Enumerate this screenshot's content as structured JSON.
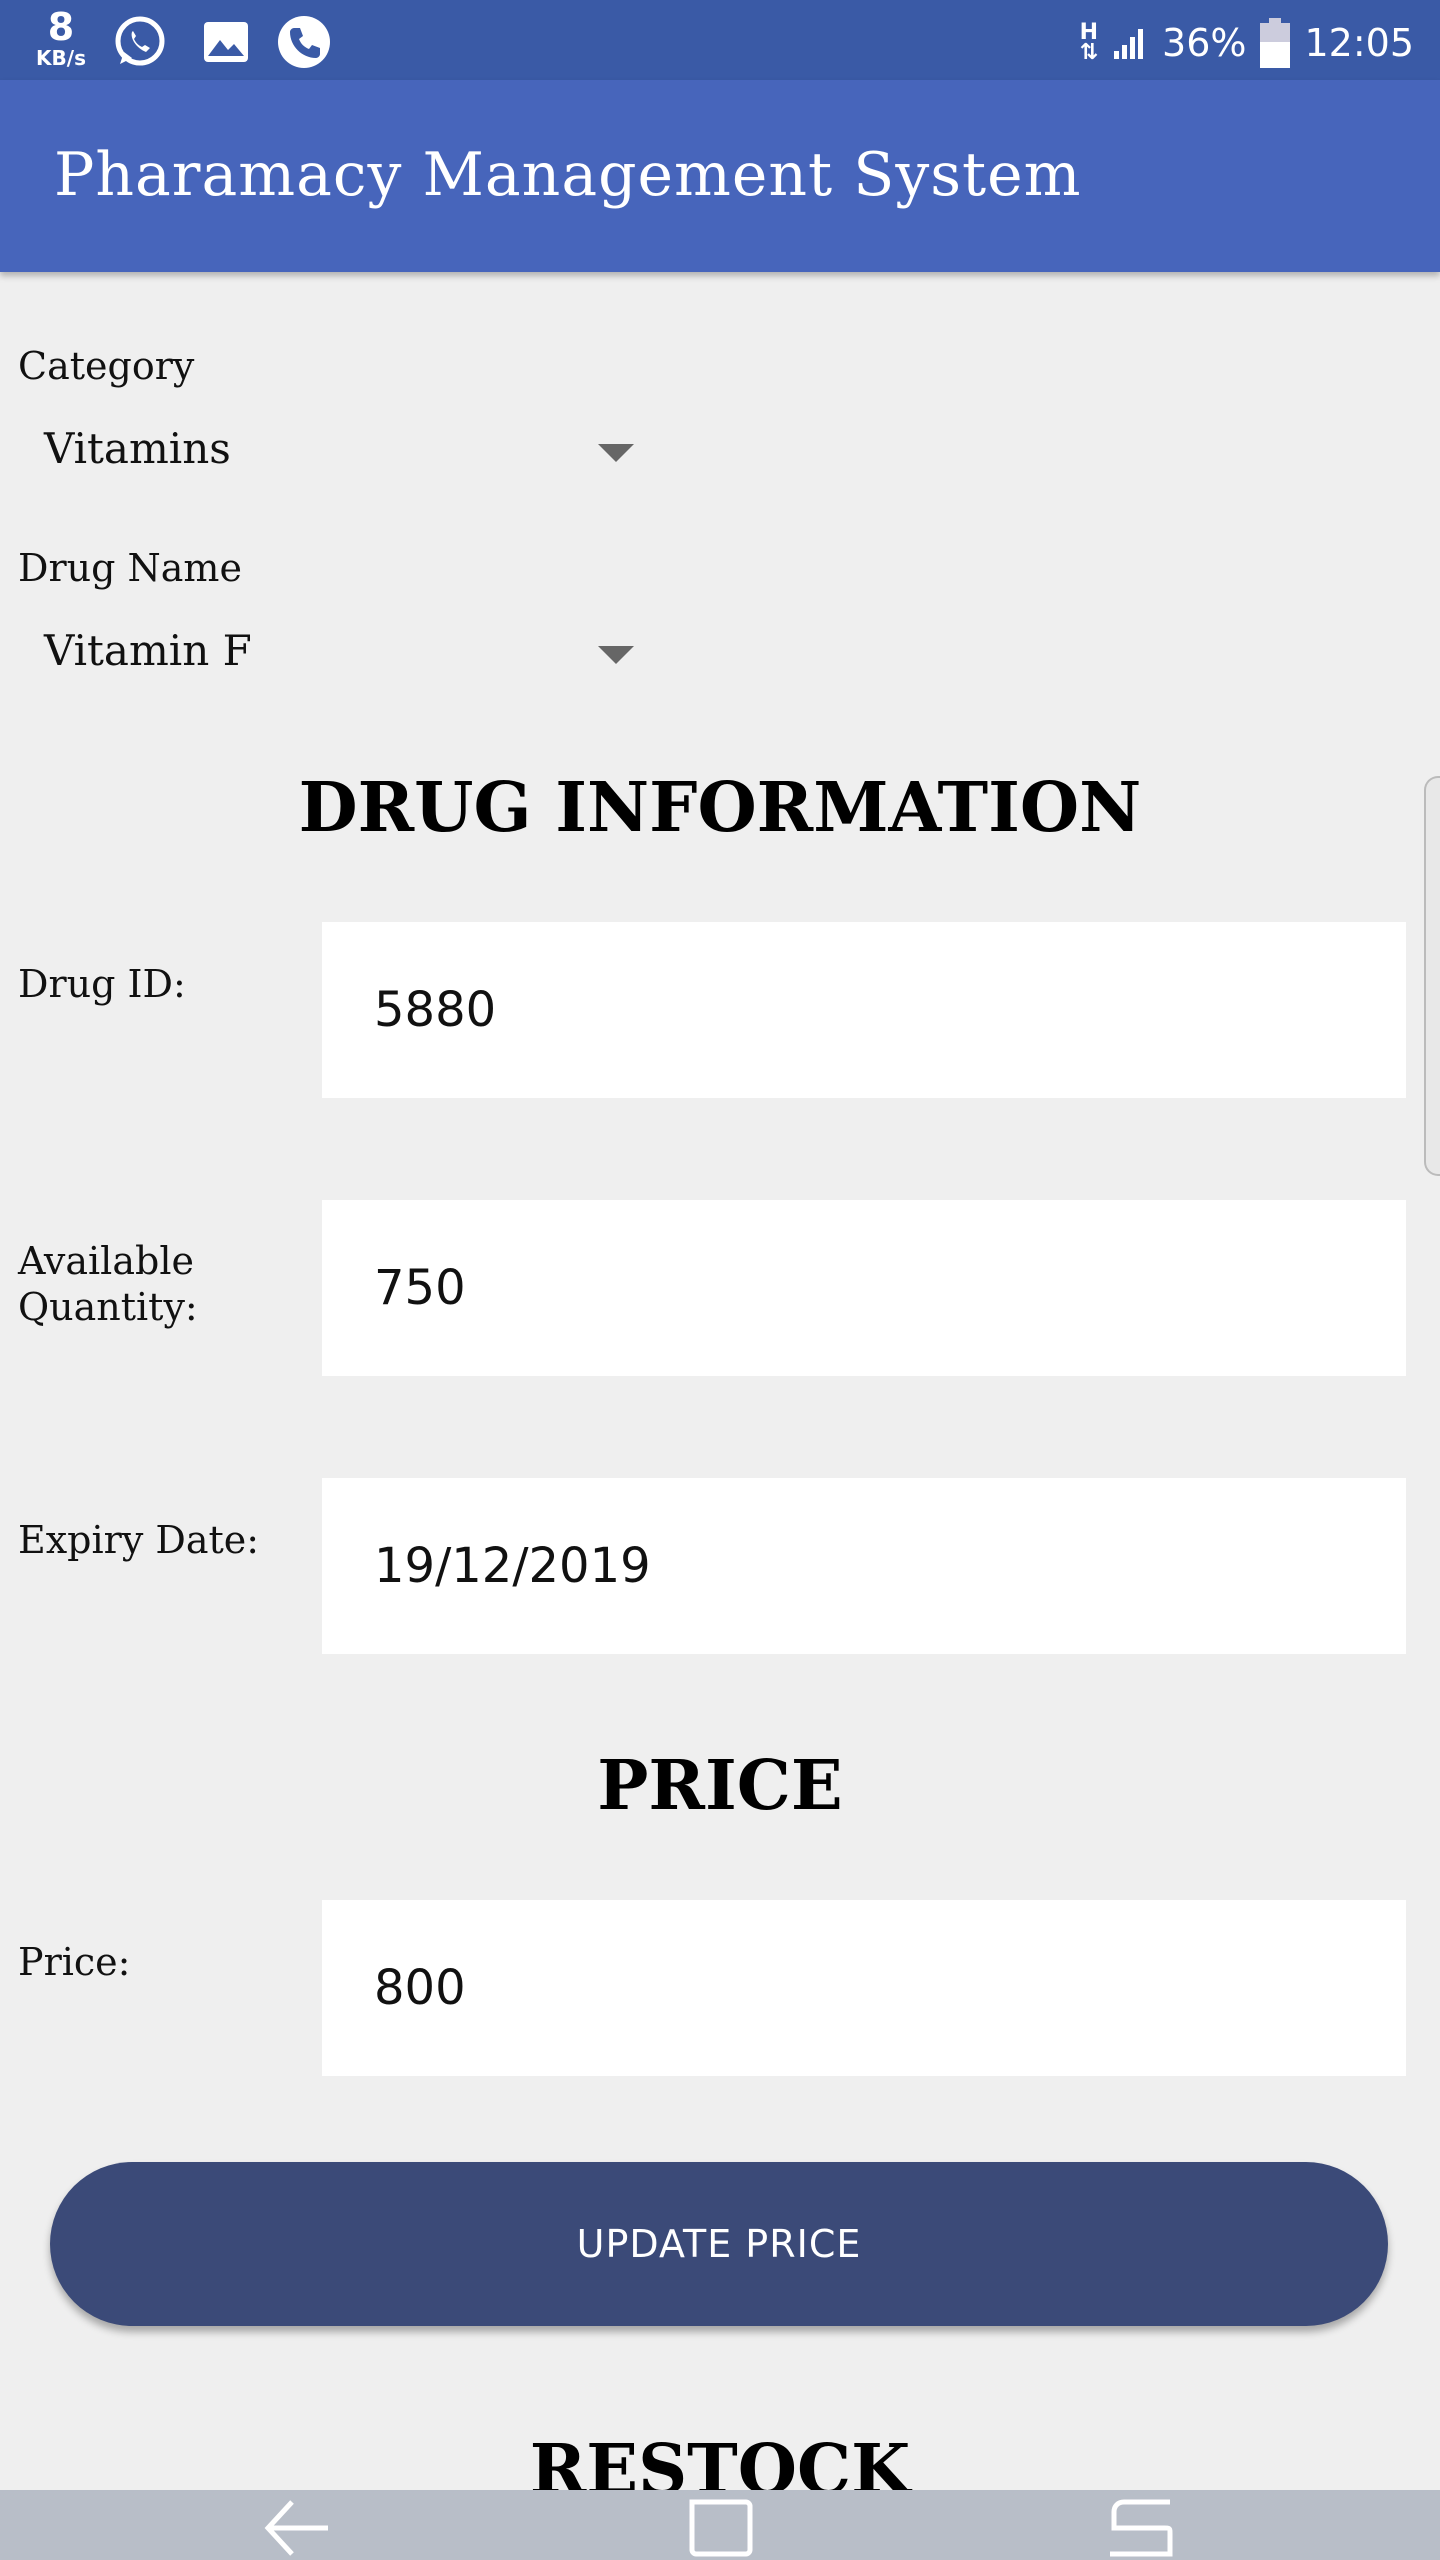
{
  "status_bar": {
    "speed_value": "8",
    "speed_unit": "KB/s",
    "network": "H",
    "battery": "36%",
    "time": "12:05",
    "icons": [
      "whatsapp-icon",
      "image-icon",
      "phone-icon",
      "signal-icon",
      "battery-icon"
    ]
  },
  "app_bar": {
    "title": "Pharamacy Management System"
  },
  "form": {
    "category_label": "Category",
    "category_value": "Vitamins",
    "drug_name_label": "Drug Name",
    "drug_name_value": "Vitamin F"
  },
  "drug_information": {
    "heading": "DRUG INFORMATION",
    "drug_id_label": "Drug ID:",
    "drug_id_value": "5880",
    "quantity_label_line1": "Available",
    "quantity_label_line2": "Quantity:",
    "quantity_value": "750",
    "expiry_label": "Expiry Date:",
    "expiry_value": "19/12/2019"
  },
  "price": {
    "heading": "PRICE",
    "price_label": "Price:",
    "price_value": "800",
    "update_button": "UPDATE PRICE"
  },
  "restock": {
    "heading": "RESTOCK"
  },
  "colors": {
    "status_bar": "#3a5aa6",
    "app_bar": "#4765bb",
    "button": "#3b4a78",
    "background": "#efefef"
  }
}
